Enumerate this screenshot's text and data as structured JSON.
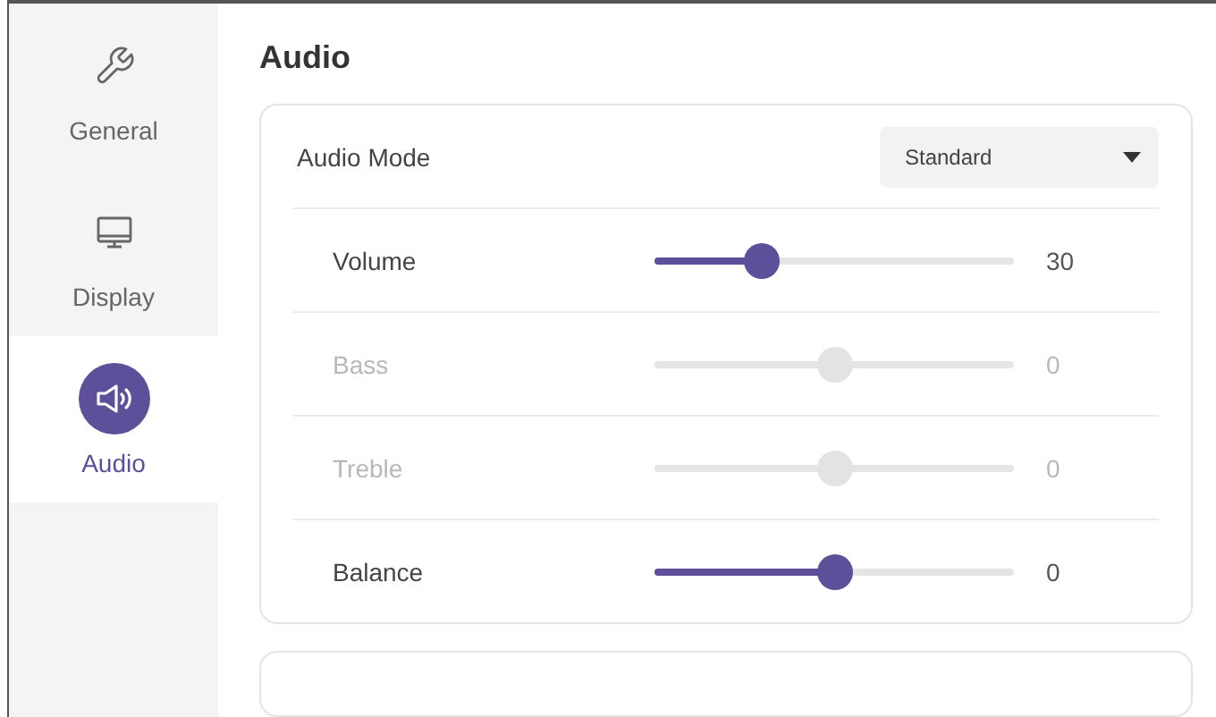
{
  "sidebar": {
    "items": [
      {
        "label": "General",
        "selected": false
      },
      {
        "label": "Display",
        "selected": false
      },
      {
        "label": "Audio",
        "selected": true
      }
    ]
  },
  "title": "Audio",
  "audio_mode": {
    "label": "Audio Mode",
    "value": "Standard"
  },
  "sliders": [
    {
      "label": "Volume",
      "level": 0.3,
      "reading": "30",
      "disabled": false
    },
    {
      "label": "Bass",
      "level": 0.5,
      "reading": "0",
      "disabled": true
    },
    {
      "label": "Treble",
      "level": 0.5,
      "reading": "0",
      "disabled": true
    },
    {
      "label": "Balance",
      "level": 0.5,
      "reading": "0",
      "disabled": false
    }
  ]
}
